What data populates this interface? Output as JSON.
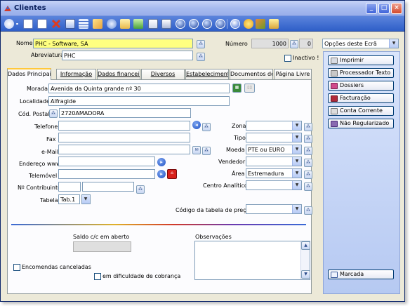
{
  "window": {
    "title": "Clientes"
  },
  "toolbar": {
    "icons": [
      "new-record-icon",
      "page-icon",
      "delete-icon",
      "edit-icon",
      "table-icon",
      "folder-icon",
      "copy-icon",
      "print-icon",
      "refresh-icon",
      "preview-icon",
      "first-icon",
      "previous-icon",
      "next-icon",
      "last-icon",
      "help-icon",
      "star-icon",
      "settings-icon",
      "lock-icon"
    ]
  },
  "header": {
    "nome_label": "Nome",
    "nome_value": "PHC - Software, SA",
    "numero_label": "Número",
    "numero_value": "1000",
    "numero_sub": "0",
    "abreviatura_label": "Abreviatura",
    "abreviatura_value": "PHC",
    "inactivo_label": "Inactivo !",
    "opcoes_select": "Opções deste Ecrã"
  },
  "tabs": [
    "Dados Principais",
    "Informação",
    "Dados financeiro",
    "Diversos",
    "Estabelecimentos",
    "Documentos de l",
    "Página Livre"
  ],
  "form": {
    "morada_label": "Morada",
    "morada_value": "Avenida da Quinta grande nº 30",
    "localidade_label": "Localidade",
    "localidade_value": "Alfragide",
    "codpostal_label": "Cód. Postal",
    "codpostal_value": "2720AMADORA",
    "telefone_label": "Telefone",
    "fax_label": "Fax",
    "email_label": "e-Mail",
    "endereco_label": "Endereço www",
    "telemovel_label": "Telemóvel",
    "contribuinte_label": "Nº Contribuinte",
    "tabela_label": "Tabela",
    "tabela_value": "Tab.1",
    "zona_label": "Zona",
    "tipo_label": "Tipo",
    "moeda_label": "Moeda",
    "moeda_value": "PTE ou EURO",
    "vendedor_label": "Vendedor",
    "area_label": "Área",
    "area_value": "Estremadura",
    "centro_label": "Centro Analítico",
    "codigo_tabela_label": "Código da tabela de preços",
    "saldo_label": "Saldo c/c em aberto",
    "observacoes_label": "Observações",
    "encomendas_label": "Encomendas canceladas",
    "dificuldade_label": "em dificuldade de cobrança"
  },
  "side_buttons": [
    {
      "label": "Imprimir",
      "color": "#d8dbe3"
    },
    {
      "label": "Processador Texto",
      "color": "#c8c8c8"
    },
    {
      "label": "Dossiers",
      "color": "#d04a8a"
    },
    {
      "label": "Facturação",
      "color": "#b02a3a"
    },
    {
      "label": "Conta Corrente",
      "color": "#dcdcdc"
    },
    {
      "label": "Não Regularizado",
      "color": "#8a6ab0"
    }
  ],
  "marcada_label": "Marcada",
  "colors": {
    "title_bar": "#a7bbef",
    "toolbar": "#2f5fc8",
    "required_field": "#ffff80",
    "tab_highlight": "#ffc83c"
  }
}
